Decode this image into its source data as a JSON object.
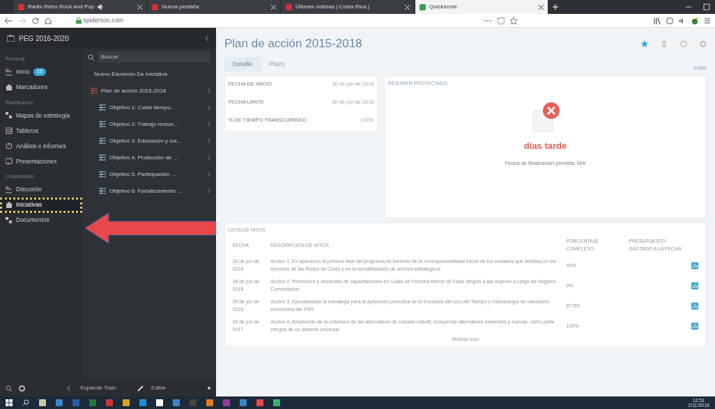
{
  "browser": {
    "tabs": [
      {
        "label": "Radio Retro Rock and Pop",
        "selected": false,
        "audio": true
      },
      {
        "label": "Nueva pestaña",
        "selected": false,
        "audio": false
      },
      {
        "label": "Últimas noticias | Costa Rica |",
        "selected": false,
        "audio": false
      },
      {
        "label": "Quickscore",
        "selected": true,
        "audio": false
      }
    ],
    "address": "spidersoc.com"
  },
  "sidebar": {
    "title": "PEG 2016-2020",
    "sections": [
      {
        "heading": "Personal",
        "items": [
          {
            "label": "Inicio",
            "badge": "15",
            "highlighted": false
          },
          {
            "label": "Marcadores",
            "highlighted": false
          }
        ]
      },
      {
        "heading": "Planificación",
        "items": [
          {
            "label": "Mapas de estrategia",
            "highlighted": false
          },
          {
            "label": "Tableros",
            "highlighted": false
          },
          {
            "label": "Análisis e Informes",
            "highlighted": false
          },
          {
            "label": "Presentaciones",
            "highlighted": false
          }
        ]
      },
      {
        "heading": "Colaboración",
        "items": [
          {
            "label": "Discusión",
            "highlighted": false
          },
          {
            "label": "Iniciativas",
            "highlighted": true
          },
          {
            "label": "Documentos",
            "highlighted": false
          }
        ]
      }
    ],
    "search_placeholder": "Buscar",
    "new_item": "Nuevo Elemento De Iniciativa",
    "tree": [
      {
        "label": "Plan de acción 2015-2018",
        "children": [
          {
            "label": "Objetivo 1: Cuido tiempo..."
          },
          {
            "label": "Objetivo 2: Trabajo remun..."
          },
          {
            "label": "Objetivo 3: Educación y cul..."
          },
          {
            "label": "Objetivo 4: Protección de ..."
          },
          {
            "label": "Objetivo 5: Participación ..."
          },
          {
            "label": "Objetivo 6: Fortalecimiento ..."
          }
        ]
      }
    ],
    "expand_all": "Expandir Todo",
    "edit": "Editar"
  },
  "page": {
    "title": "Plan de acción 2015-2018",
    "tabs": [
      {
        "label": "Detalle",
        "selected": true
      },
      {
        "label": "Plazo",
        "selected": false
      }
    ],
    "edit_link": "Editar",
    "details": [
      {
        "label": "FECHA DE INICIO",
        "value": "30 de jun de 2015"
      },
      {
        "label": "FECHA LIMITE",
        "value": "30 de jun de 2018"
      },
      {
        "label": "% DE TIEMPO TRANSCURRIDO",
        "value": "100%"
      }
    ],
    "summary": {
      "heading": "RESUMEN PROYECTADO",
      "status": "días tarde",
      "note": "Fecha de finalización prevista: N/A"
    },
    "milestones": {
      "heading": "LISTA DE HITOS",
      "columns": [
        "FECHA",
        "DESCRIPCIÓN DE HITOS",
        "PORCENTAJE COMPLETO",
        "PRESUPUESTO GASTADO A LA FECHA"
      ],
      "rows": [
        {
          "date": "30 de jun de 2018",
          "description": "Acción 1: En aplicación la primera fase del programa de fomento de la corresponsabilidad social de los cuidados que enfatiza en los servicios de las Redes de Cuido y en la sensibilización de actores estratégicos",
          "percent": "40%"
        },
        {
          "date": "30 de jun de 2018",
          "description": "Acción 2: Promoción y desarrollo de capacitaciones en Cuido de Persona Menor de Edad dirigido a las mujeres a cargo de Hogares Comunitarios",
          "percent": "0%"
        },
        {
          "date": "30 de jun de 2016",
          "description": "Acción 3: Ejecutándose la estrategia para la aplicación periódica de la Encuesta del Uso del Tiempo y metodología de valoración económica del TNR",
          "percent": "87.5%"
        },
        {
          "date": "30 de jun de 2017",
          "description": "Acción 4: Ampliación de la cobertura de las alternativas de cuidado infantil, incluyendo alternativas existentes y nuevas, como parte integral de un sistema universal",
          "percent": "100%"
        }
      ],
      "more": "Mostrar todo"
    }
  },
  "taskbar": {
    "time": "12:51",
    "date": "2/11/2018"
  }
}
